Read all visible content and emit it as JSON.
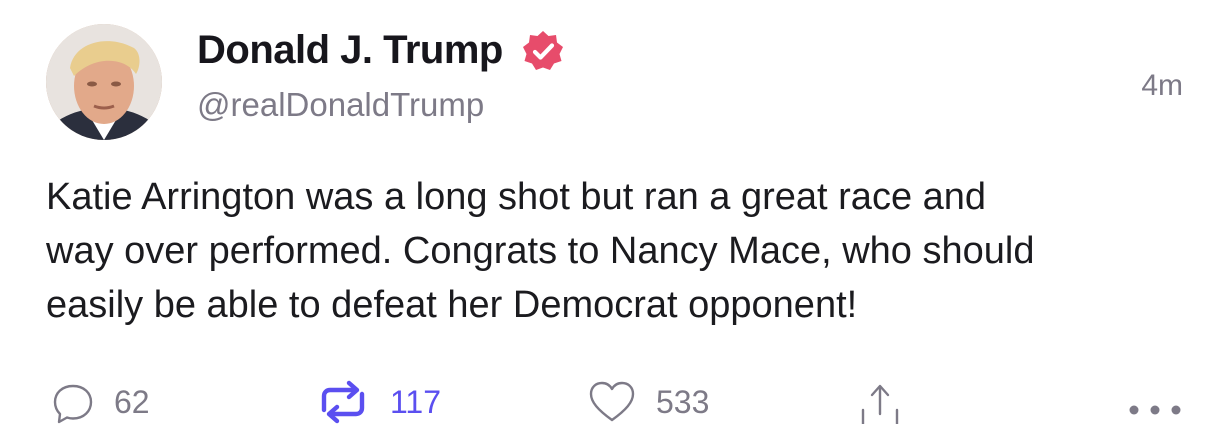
{
  "author": {
    "name": "Donald J. Trump",
    "handle": "@realDonaldTrump",
    "verified": true,
    "avatar": "profile photo of a man"
  },
  "timestamp": "4m",
  "post": {
    "text": "Katie Arrington was a long shot but ran a great race and\nway over performed. Congrats to Nancy Mace, who should\neasily be able to defeat her Democrat opponent!"
  },
  "actions": {
    "replies": "62",
    "retweets": "117",
    "likes": "533",
    "icons": [
      "reply-icon",
      "retweet-icon",
      "like-icon",
      "share-icon",
      "more-icon"
    ]
  },
  "colors": {
    "verified_badge": "#e74c6b",
    "retweet_active": "#5b4ff0",
    "secondary_text": "#7d7a87",
    "primary_text": "#1b1b1f"
  }
}
